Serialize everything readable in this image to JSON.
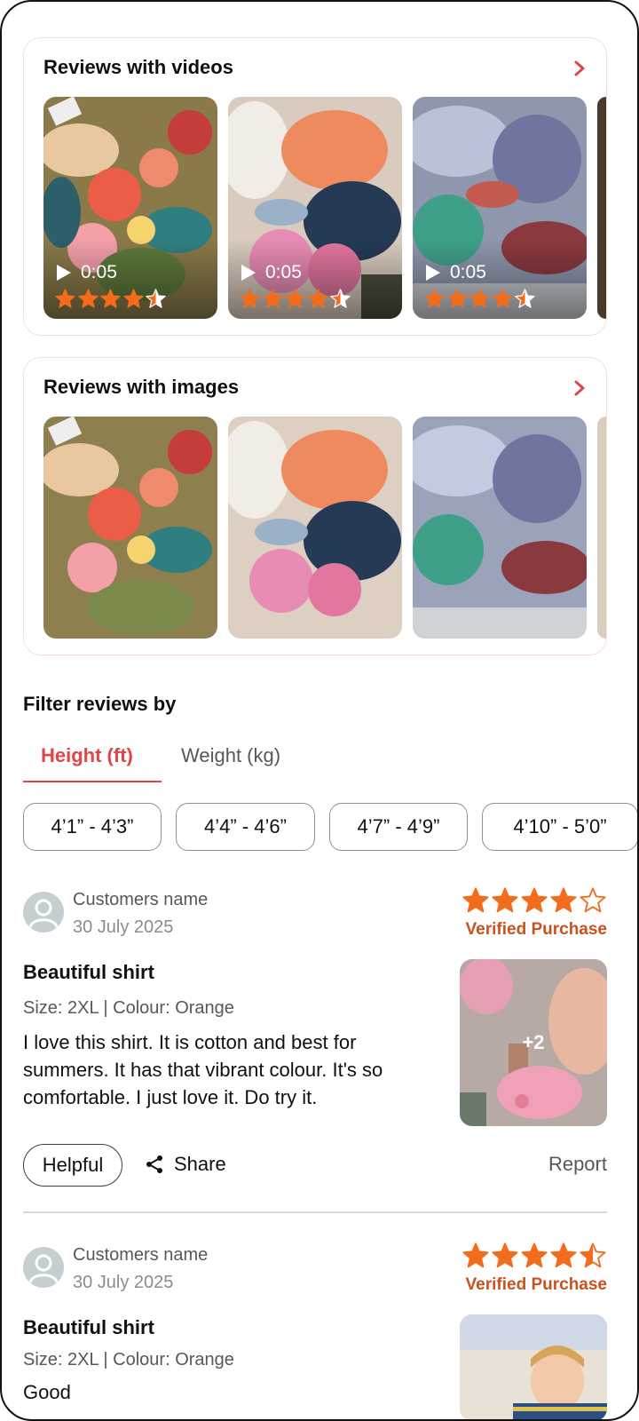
{
  "video_section": {
    "title": "Reviews with videos",
    "items": [
      {
        "duration": "0:05",
        "rating": 4.5
      },
      {
        "duration": "0:05",
        "rating": 4.5
      },
      {
        "duration": "0:05",
        "rating": 4.5
      }
    ]
  },
  "image_section": {
    "title": "Reviews with images"
  },
  "filter": {
    "title": "Filter reviews by",
    "tabs": [
      {
        "label": "Height (ft)",
        "active": true
      },
      {
        "label": "Weight (kg)",
        "active": false
      }
    ],
    "chips": [
      "4’1” - 4’3”",
      "4’4” - 4’6”",
      "4’7” - 4’9”",
      "4’10” - 5’0”"
    ]
  },
  "reviews": [
    {
      "customer": "Customers name",
      "date": "30 July 2025",
      "rating": 4,
      "badge": "Verified Purchase",
      "title": "Beautiful shirt",
      "meta": "Size: 2XL | Colour: Orange",
      "body": "I love this shirt. It is cotton and best for summers. It has that vibrant colour. It's so comfortable. I just love it. Do try it.",
      "extra_images": "+2",
      "helpful_label": "Helpful",
      "share_label": "Share",
      "report_label": "Report"
    },
    {
      "customer": "Customers name",
      "date": "30 July 2025",
      "rating": 4.5,
      "badge": "Verified Purchase",
      "title": "Beautiful shirt",
      "meta": "Size: 2XL | Colour: Orange",
      "body": "Good"
    }
  ],
  "colors": {
    "star": "#f26c1c",
    "accent": "#e0454a",
    "verified": "#c7511f",
    "card_border": "#f8ddd6"
  },
  "icons": [
    "chevron-right-icon",
    "play-icon",
    "star-icon",
    "share-icon",
    "avatar-icon"
  ]
}
